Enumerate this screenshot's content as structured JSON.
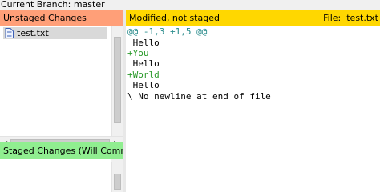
{
  "branch_label": "Current Branch: master",
  "unstaged": {
    "header": "Unstaged Changes",
    "files": [
      {
        "name": "test.txt"
      }
    ]
  },
  "staged": {
    "header": "Staged Changes (Will Commit)"
  },
  "diff": {
    "status": "Modified, not staged",
    "file_label": "File:",
    "file_name": "test.txt",
    "lines": [
      {
        "text": "@@ -1,3 +1,5 @@",
        "kind": "hunk"
      },
      {
        "text": " Hello",
        "kind": "context"
      },
      {
        "text": "+You",
        "kind": "added"
      },
      {
        "text": " Hello",
        "kind": "context"
      },
      {
        "text": "+World",
        "kind": "added"
      },
      {
        "text": " Hello",
        "kind": "context"
      },
      {
        "text": "\\ No newline at end of file",
        "kind": "context"
      }
    ]
  },
  "colors": {
    "unstaged_header": "#ff9f78",
    "staged_header": "#90ee90",
    "diff_header": "#ffd700",
    "hunk": "#2a8c8c",
    "added": "#2a9a2a"
  }
}
